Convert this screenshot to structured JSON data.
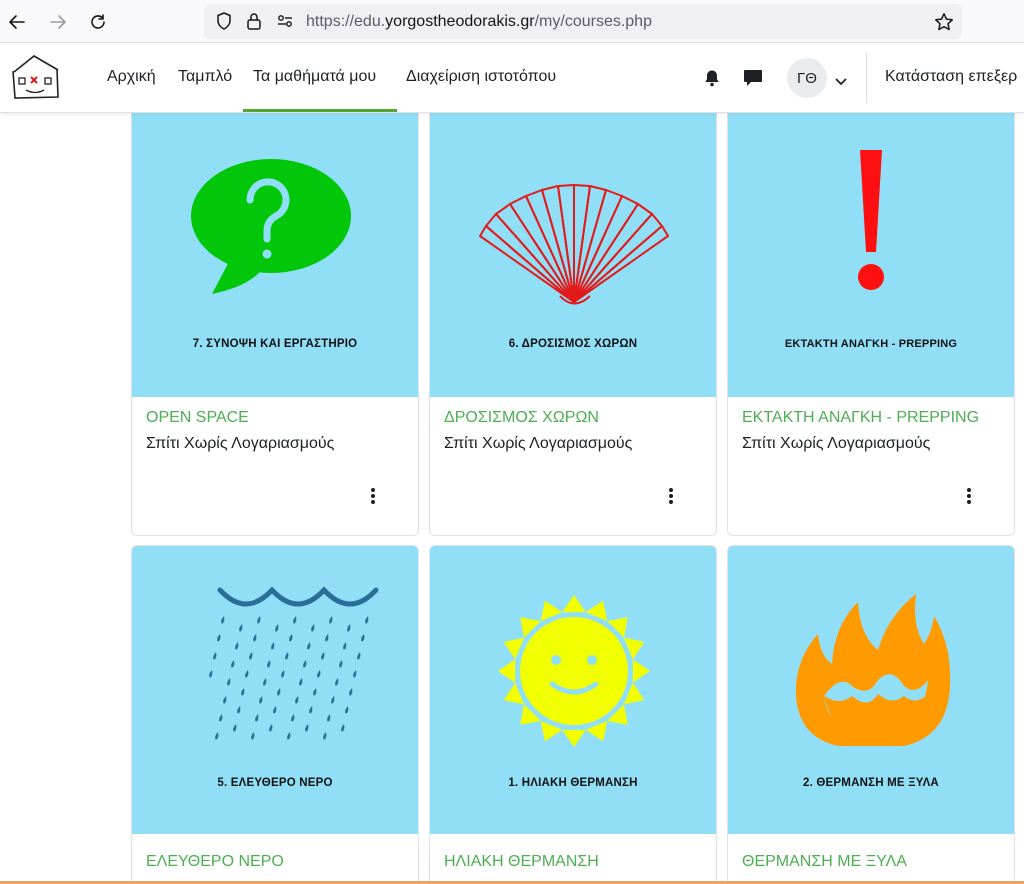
{
  "browser": {
    "url_prefix": "https://edu.",
    "url_host": "yorgostheodorakis.gr",
    "url_path": "/my/courses.php"
  },
  "navbar": {
    "items": [
      {
        "label": "Αρχική"
      },
      {
        "label": "Ταμπλό"
      },
      {
        "label": "Τα μαθήματά μου",
        "active": true
      },
      {
        "label": "Διαχείριση ιστοτόπου"
      }
    ],
    "user_initials": "ΓΘ",
    "edit_mode_label": "Κατάσταση επεξερ",
    "active_color": "#55a630"
  },
  "courses": [
    {
      "caption": "7. ΣΥΝΟΨΗ ΚΑΙ ΕΡΓΑΣΤΗΡΙΟ",
      "name": "OPEN SPACE",
      "category": "Σπίτι Χωρίς Λογαριασμούς",
      "icon": "question-speech-bubble-icon"
    },
    {
      "caption": "6. ΔΡΟΣΙΣΜΟΣ ΧΩΡΩΝ",
      "name": "ΔΡΟΣΙΣΜΟΣ ΧΩΡΩΝ",
      "category": "Σπίτι Χωρίς Λογαριασμούς",
      "icon": "hand-fan-icon"
    },
    {
      "caption": "ΕΚΤΑΚΤΗ ΑΝΑΓΚΗ - PREPPING",
      "name": "ΕΚΤΑΚΤΗ ΑΝΑΓΚΗ - PREPPING",
      "category": "Σπίτι Χωρίς Λογαριασμούς",
      "icon": "exclamation-icon"
    },
    {
      "caption": "5. ΕΛΕΥΘΕΡΟ ΝΕΡΟ",
      "name": "ΕΛΕΥΘΕΡΟ ΝΕΡΟ",
      "category": "",
      "icon": "rain-cloud-icon"
    },
    {
      "caption": "1. ΗΛΙΑΚΗ ΘΕΡΜΑΝΣΗ",
      "name": "ΗΛΙΑΚΗ ΘΕΡΜΑΝΣΗ",
      "category": "",
      "icon": "smiling-sun-icon"
    },
    {
      "caption": "2. ΘΕΡΜΑΝΣΗ ΜΕ ΞΥΛΑ",
      "name": "ΘΕΡΜΑΝΣΗ ΜΕ ΞΥΛΑ",
      "category": "",
      "icon": "fire-icon"
    }
  ],
  "colors": {
    "card_image_bg": "#91dff6",
    "course_name": "#4caf50"
  }
}
